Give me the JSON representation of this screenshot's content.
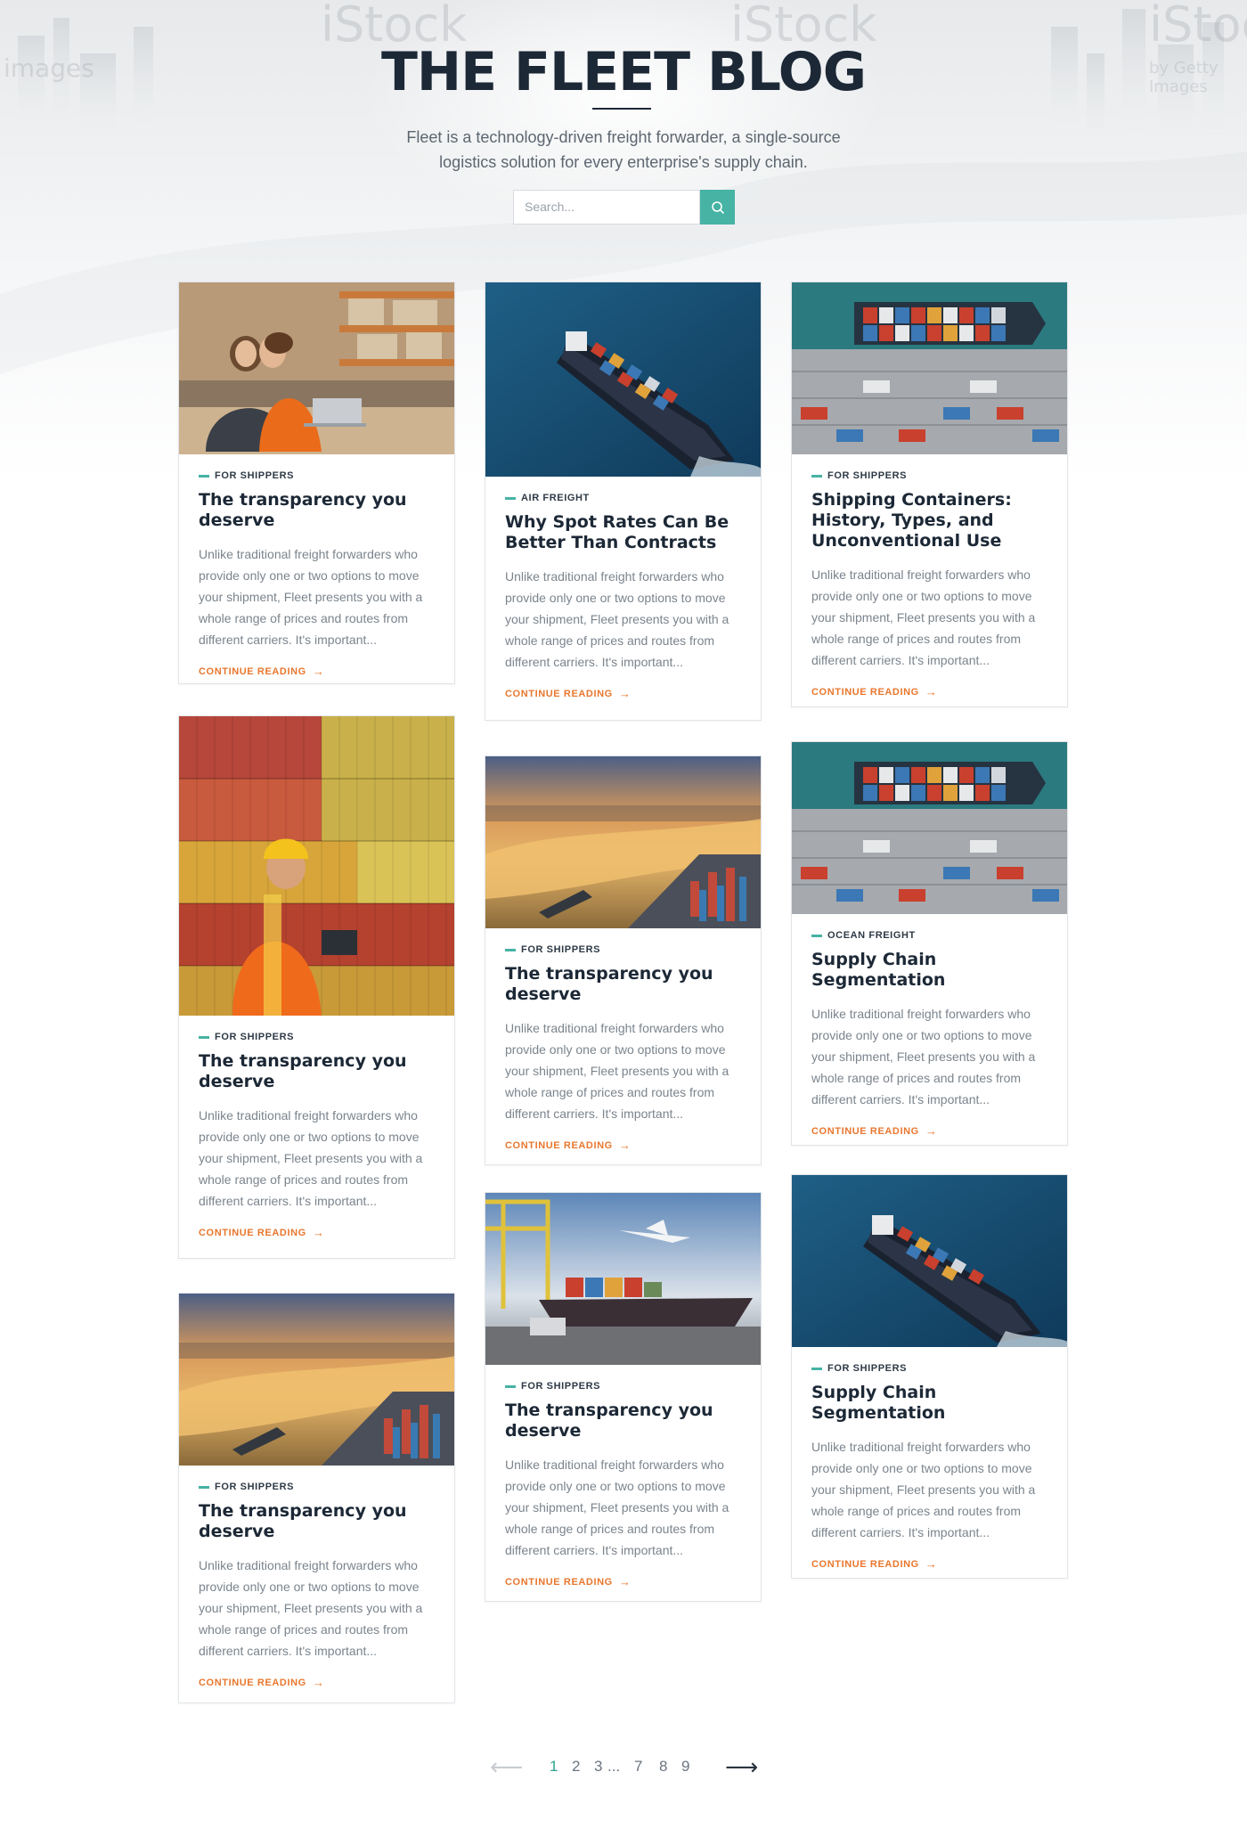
{
  "hero": {
    "title": "THE FLEET BLOG",
    "subtitle_line1": "Fleet is a technology-driven freight forwarder, a single-source",
    "subtitle_line2": "logistics solution for every enterprise's supply chain.",
    "search_placeholder": "Search...",
    "watermarks": [
      "iStock",
      "by Getty Images",
      "images"
    ]
  },
  "colors": {
    "accent": "#46b3a4",
    "link": "#e8772e",
    "heading": "#1c2836"
  },
  "image_watermark": "iStock",
  "image_watermark_sub": "by Getty Images",
  "posts": [
    {
      "category": "FOR SHIPPERS",
      "title_1": "The transparency you",
      "title_2": "deserve",
      "title_3": "",
      "image": "warehouse-workers-photo"
    },
    {
      "category": "AIR FREIGHT",
      "title_1": "Why Spot Rates Can Be",
      "title_2": "Better Than Contracts",
      "title_3": "",
      "image": "cargo-ship-sea-photo"
    },
    {
      "category": "FOR SHIPPERS",
      "title_1": "Shipping Containers:",
      "title_2": "History, Types, and",
      "title_3": "Unconventional Use",
      "image": "container-port-aerial-photo"
    },
    {
      "category": "FOR SHIPPERS",
      "title_1": "The transparency you",
      "title_2": "deserve",
      "title_3": "",
      "image": "container-stack-worker-photo"
    },
    {
      "category": "FOR SHIPPERS",
      "title_1": "The transparency you",
      "title_2": "deserve",
      "title_3": "",
      "image": "sunset-port-city-photo"
    },
    {
      "category": "OCEAN FREIGHT",
      "title_1": "Supply Chain",
      "title_2": "Segmentation",
      "title_3": "",
      "image": "container-port-aerial-photo"
    },
    {
      "category": "FOR SHIPPERS",
      "title_1": "The transparency you",
      "title_2": "deserve",
      "title_3": "",
      "image": "sunset-port-city-photo"
    },
    {
      "category": "FOR SHIPPERS",
      "title_1": "The transparency you",
      "title_2": "deserve",
      "title_3": "",
      "image": "logistics-plane-ship-truck-photo"
    },
    {
      "category": "FOR SHIPPERS",
      "title_1": "Supply Chain",
      "title_2": "Segmentation",
      "title_3": "",
      "image": "cargo-ship-sea-photo"
    }
  ],
  "excerpt_lines": [
    "Unlike traditional freight forwarders who",
    "provide only one or two options to move",
    "your shipment, Fleet presents you with a",
    "whole range of prices and routes from",
    "different carriers. It's important..."
  ],
  "continue_label": "CONTINUE READING",
  "continue_icon": "arrow-right-icon",
  "pagination": {
    "prev_icon": "arrow-left-icon",
    "next_icon": "arrow-right-icon",
    "pages": [
      "1",
      "2",
      "3",
      "...",
      "7",
      "8",
      "9"
    ],
    "current": "1"
  }
}
